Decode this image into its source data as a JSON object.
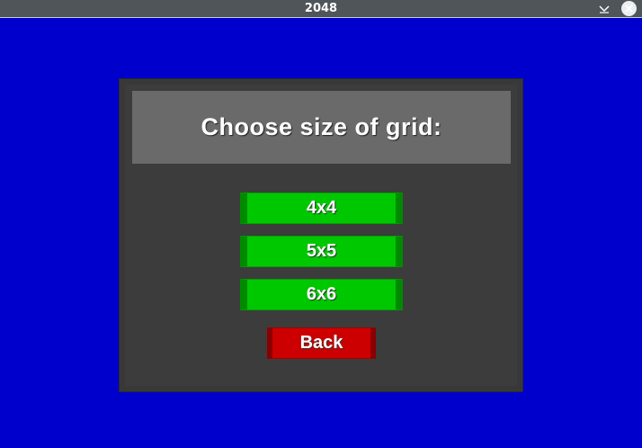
{
  "window": {
    "title": "2048",
    "minimize_icon": "chevron-down-icon",
    "close_icon": "close-icon"
  },
  "dialog": {
    "heading": "Choose size of grid:",
    "options": [
      "4x4",
      "5x5",
      "6x6"
    ],
    "back_label": "Back"
  },
  "colors": {
    "background": "#0000cc",
    "option_button": "#00c800",
    "back_button": "#cc0000",
    "panel": "#3c3c3c",
    "header": "#6a6a6a"
  }
}
